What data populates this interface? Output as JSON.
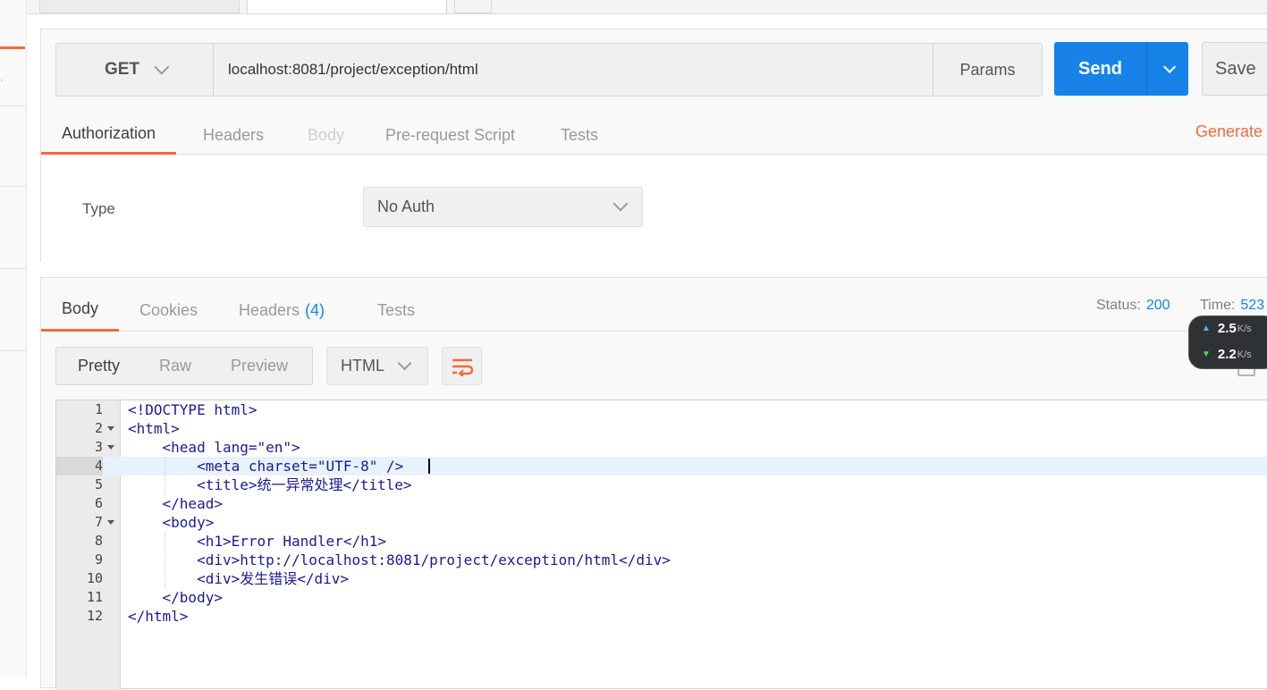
{
  "request": {
    "method": "GET",
    "url": "localhost:8081/project/exception/html",
    "params_label": "Params",
    "send_label": "Send",
    "save_label": "Save",
    "tabs": [
      "Authorization",
      "Headers",
      "Body",
      "Pre-request Script",
      "Tests"
    ],
    "generate_label": "Generate",
    "auth": {
      "type_label": "Type",
      "type_value": "No Auth"
    }
  },
  "response": {
    "tabs": {
      "body": "Body",
      "cookies": "Cookies",
      "headers": "Headers",
      "headers_count": "(4)",
      "tests": "Tests"
    },
    "status_label": "Status:",
    "status_value": "200",
    "time_label": "Time:",
    "time_value": "523",
    "view_modes": [
      "Pretty",
      "Raw",
      "Preview"
    ],
    "format": "HTML",
    "code_lines": [
      "<!DOCTYPE html>",
      "<html>",
      "    <head lang=\"en\">",
      "        <meta charset=\"UTF-8\" />",
      "        <title>统一异常处理</title>",
      "    </head>",
      "    <body>",
      "        <h1>Error Handler</h1>",
      "        <div>http://localhost:8081/project/exception/html</div>",
      "        <div>发生错误</div>",
      "    </body>",
      "</html>"
    ],
    "line_numbers": [
      "1",
      "2",
      "3",
      "4",
      "5",
      "6",
      "7",
      "8",
      "9",
      "10",
      "11",
      "12"
    ]
  },
  "net_speed": {
    "up": "2.5",
    "up_unit": "K/s",
    "down": "2.2",
    "down_unit": "K/s"
  },
  "colors": {
    "accent": "#f26b3a",
    "primary": "#1783e8"
  }
}
